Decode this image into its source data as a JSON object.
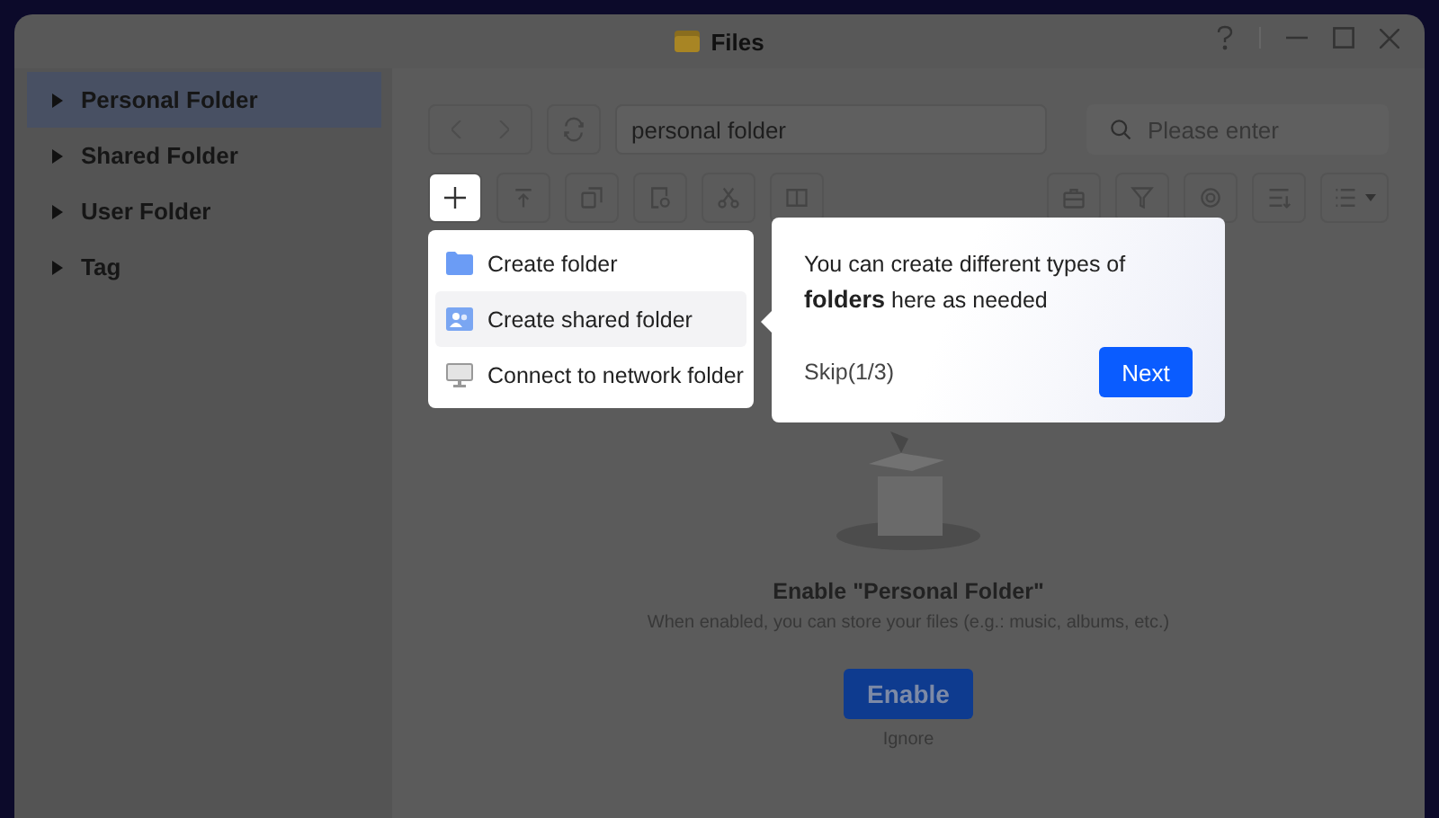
{
  "window": {
    "title": "Files"
  },
  "sidebar": {
    "items": [
      {
        "label": "Personal Folder",
        "selected": true,
        "expanded": false
      },
      {
        "label": "Shared Folder",
        "selected": false,
        "expanded": false
      },
      {
        "label": "User Folder",
        "selected": false,
        "expanded": false
      },
      {
        "label": "Tag",
        "selected": false,
        "expanded": false
      }
    ]
  },
  "path_field": {
    "value": "personal folder"
  },
  "search": {
    "placeholder": "Please enter"
  },
  "create_menu": {
    "items": [
      {
        "label": "Create folder",
        "kind": "folder",
        "selected": false
      },
      {
        "label": "Create shared folder",
        "kind": "shared",
        "selected": true
      },
      {
        "label": "Connect to network folder",
        "kind": "network",
        "selected": false
      }
    ]
  },
  "guide": {
    "text": "You can create different types of **folders** here as needed",
    "skip": "Skip(1/3)",
    "next": "Next"
  },
  "empty_state": {
    "title": "Enable \"Personal Folder\"",
    "description": "When enabled, you can store your files (e.g.: music, albums, etc.)",
    "enable": "Enable",
    "ignore": "Ignore"
  }
}
